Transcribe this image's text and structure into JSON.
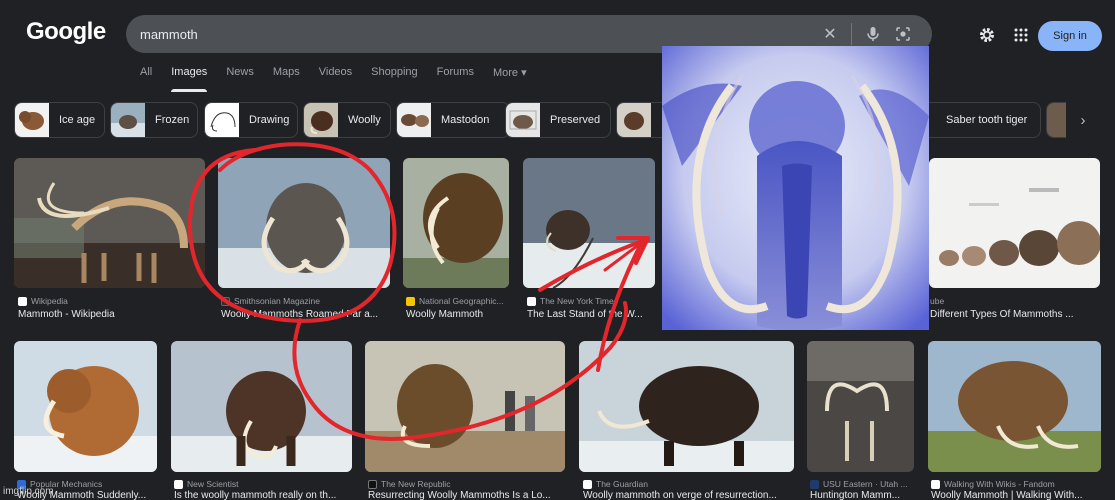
{
  "header": {
    "logo": "Google",
    "search_query": "mammoth",
    "signin_label": "Sign in"
  },
  "tabs": [
    "All",
    "Images",
    "News",
    "Maps",
    "Videos",
    "Shopping",
    "Forums",
    "More ▾"
  ],
  "chips": [
    "Ice age",
    "Frozen",
    "Drawing",
    "Woolly",
    "Mastodon",
    "Preserved",
    "",
    "Saber tooth tiger"
  ],
  "row1": [
    {
      "source": "Wikipedia",
      "title": "Mammoth - Wikipedia"
    },
    {
      "source": "Smithsonian Magazine",
      "title": "Woolly Mammoths Roamed Far a..."
    },
    {
      "source": "National Geographic...",
      "title": "Woolly Mammoth"
    },
    {
      "source": "The New York Times",
      "title": "The Last Stand of the W..."
    },
    {
      "source": "ube",
      "title": "Different Types Of Mammoths ..."
    }
  ],
  "row2": [
    {
      "source": "Popular Mechanics",
      "title": "Woolly Mammoth Suddenly..."
    },
    {
      "source": "New Scientist",
      "title": "Is the woolly mammoth really on th..."
    },
    {
      "source": "The New Republic",
      "title": "Resurrecting Woolly Mammoths Is a Lo..."
    },
    {
      "source": "The Guardian",
      "title": "Woolly mammoth on verge of resurrection..."
    },
    {
      "source": "USU Eastern · Utah ...",
      "title": "Huntington Mamm..."
    },
    {
      "source": "Walking With Wikis - Fandom",
      "title": "Woolly Mammoth | Walking With..."
    }
  ],
  "watermark": "imgflip.com",
  "colors": {
    "background": "#202124",
    "search_bar": "#4d5156",
    "signin": "#8ab4f8",
    "annotation_red": "#e3262b"
  }
}
